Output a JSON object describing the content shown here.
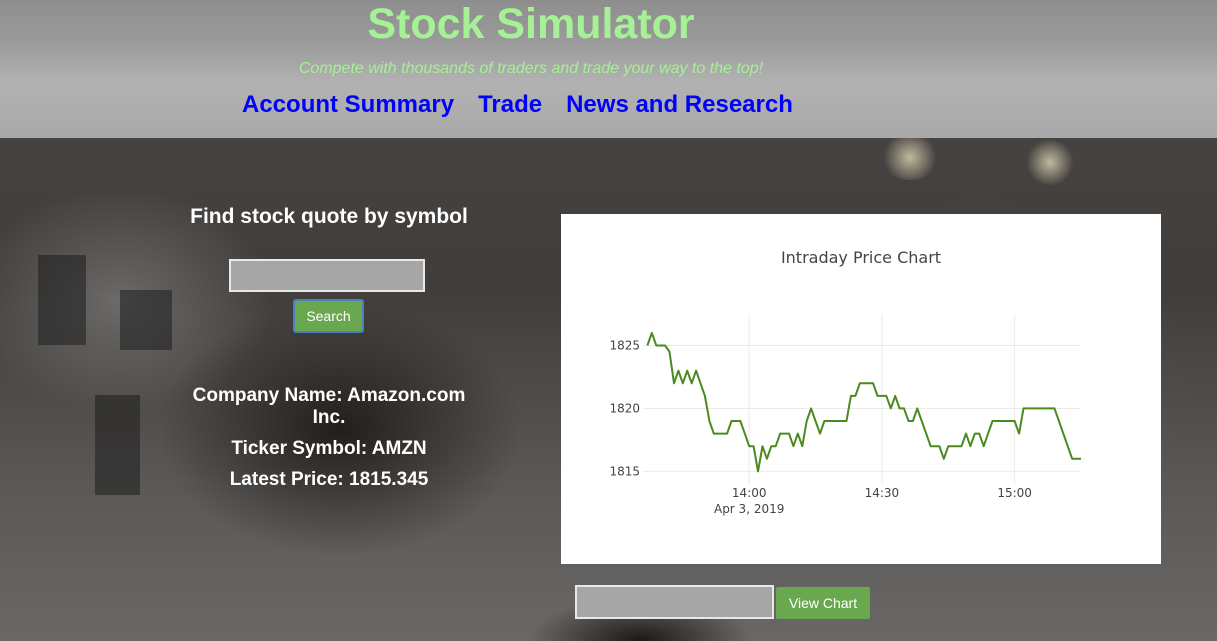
{
  "header": {
    "title": "Stock Simulator",
    "tagline": "Compete with thousands of traders and trade your way to the top!",
    "nav": [
      {
        "label": "Account Summary"
      },
      {
        "label": "Trade"
      },
      {
        "label": "News and Research"
      }
    ]
  },
  "quote": {
    "heading": "Find stock quote by symbol",
    "input_value": "",
    "search_label": "Search",
    "company_name": "Company Name: Amazon.com Inc.",
    "ticker": "Ticker Symbol: AMZN",
    "latest_price": "Latest Price: 1815.345"
  },
  "chart_controls": {
    "input_value": "",
    "view_chart_label": "View Chart"
  },
  "colors": {
    "title_green": "#a6f095",
    "nav_blue": "#0000ff",
    "button_green": "#6aa84f",
    "line_green": "#4a8a1e"
  },
  "chart_data": {
    "type": "line",
    "title": "Intraday Price Chart",
    "xlabel": "",
    "ylabel": "",
    "x_tick_labels": [
      "14:00",
      "14:30",
      "15:00"
    ],
    "x_tick_sublabel": "Apr 3, 2019",
    "y_ticks": [
      1815,
      1820,
      1825
    ],
    "xlim": [
      "13:36",
      "15:15"
    ],
    "ylim": [
      1814,
      1827.5
    ],
    "grid": true,
    "series": [
      {
        "color": "#4a8a1e",
        "x": [
          "13:37",
          "13:38",
          "13:39",
          "13:40",
          "13:41",
          "13:42",
          "13:43",
          "13:44",
          "13:45",
          "13:46",
          "13:47",
          "13:48",
          "13:49",
          "13:50",
          "13:51",
          "13:52",
          "13:53",
          "13:54",
          "13:55",
          "13:56",
          "13:57",
          "13:58",
          "13:59",
          "14:00",
          "14:01",
          "14:02",
          "14:03",
          "14:04",
          "14:05",
          "14:06",
          "14:07",
          "14:08",
          "14:09",
          "14:10",
          "14:11",
          "14:12",
          "14:13",
          "14:14",
          "14:15",
          "14:16",
          "14:17",
          "14:18",
          "14:19",
          "14:20",
          "14:21",
          "14:22",
          "14:23",
          "14:24",
          "14:25",
          "14:26",
          "14:27",
          "14:28",
          "14:29",
          "14:30",
          "14:31",
          "14:32",
          "14:33",
          "14:34",
          "14:35",
          "14:36",
          "14:37",
          "14:38",
          "14:39",
          "14:40",
          "14:41",
          "14:42",
          "14:43",
          "14:44",
          "14:45",
          "14:46",
          "14:47",
          "14:48",
          "14:49",
          "14:50",
          "14:51",
          "14:52",
          "14:53",
          "14:54",
          "14:55",
          "14:56",
          "14:57",
          "14:58",
          "14:59",
          "15:00",
          "15:01",
          "15:02",
          "15:03",
          "15:04",
          "15:05",
          "15:06",
          "15:07",
          "15:08",
          "15:09",
          "15:10",
          "15:11",
          "15:12",
          "15:13",
          "15:14",
          "15:15"
        ],
        "values": [
          1825,
          1826,
          1825,
          1825,
          1825,
          1824.5,
          1822,
          1823,
          1822,
          1823,
          1822,
          1823,
          1822,
          1821,
          1819,
          1818,
          1818,
          1818,
          1818,
          1819,
          1819,
          1819,
          1818,
          1817,
          1817,
          1815,
          1817,
          1816,
          1817,
          1817,
          1818,
          1818,
          1818,
          1817,
          1818,
          1817,
          1819,
          1820,
          1819,
          1818,
          1819,
          1819,
          1819,
          1819,
          1819,
          1819,
          1821,
          1821,
          1822,
          1822,
          1822,
          1822,
          1821,
          1821,
          1821,
          1820,
          1821,
          1820,
          1820,
          1819,
          1819,
          1820,
          1819,
          1818,
          1817,
          1817,
          1817,
          1816,
          1817,
          1817,
          1817,
          1817,
          1818,
          1817,
          1818,
          1818,
          1817,
          1818,
          1819,
          1819,
          1819,
          1819,
          1819,
          1819,
          1818,
          1820,
          1820,
          1820,
          1820,
          1820,
          1820,
          1820,
          1820,
          1819,
          1818,
          1817,
          1816,
          1816,
          1816
        ]
      }
    ]
  }
}
